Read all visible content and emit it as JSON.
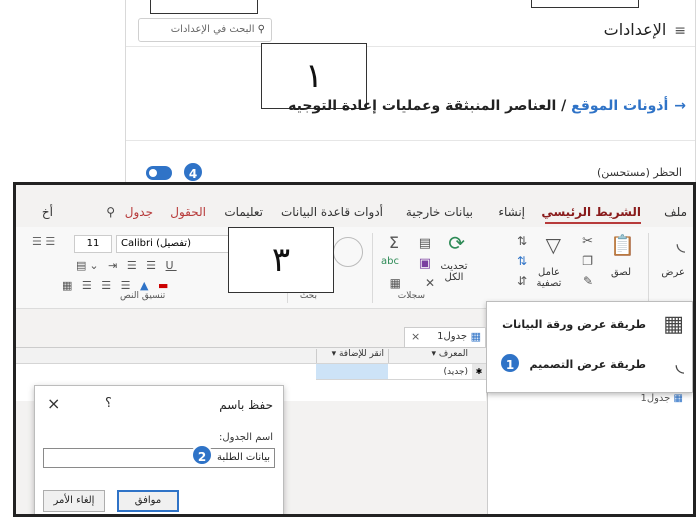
{
  "settings_page": {
    "title": "الإعدادات",
    "menu_icon": "menu-icon",
    "search_placeholder": "البحث في الإعدادات",
    "search_icon": "search-icon",
    "breadcrumb_link": "أذونات الموقع",
    "breadcrumb_sep": "/",
    "breadcrumb_current": "العناصر المنبثقة وعمليات إعادة التوجيه",
    "back_icon": "arrow-back-icon",
    "block_label": "الحظر (مستحسن)",
    "toggle_badge": "4",
    "frame_1_label": "١"
  },
  "access": {
    "tabs": {
      "file": "ملف",
      "home": "الشريط الرئيسي",
      "create": "إنشاء",
      "external": "بيانات خارجية",
      "db_tools": "أدوات قاعدة البيانات",
      "help": "تعليمات",
      "fields": "الحقول",
      "table": "جدول",
      "tell": "أخ"
    },
    "ribbon": {
      "view_label": "عرض",
      "paste_label": "لصق",
      "filter_label": "عامل تصفية",
      "refresh_label": "تحديث الكل",
      "font_name": "Calibri (تفصيل)",
      "font_size": "11",
      "group_records": "سجلات",
      "group_find": "بحث",
      "group_text": "تنسيق النص",
      "frame_3_label": "٣"
    },
    "view_menu": {
      "datasheet": "طريقة عرض ورقة البيانات",
      "design": "طريقة عرض التصميم",
      "design_badge": "1"
    },
    "table_tab": {
      "name": "جدول1",
      "close": "×"
    },
    "grid": {
      "col_id": "المعرف",
      "col_add": "انقر للإضافة",
      "new_row": "(جديد)"
    },
    "nav_item": "جدول1",
    "save_dialog": {
      "title": "حفظ باسم",
      "help": "؟",
      "close": "×",
      "field_label": "اسم الجدول:",
      "field_value": "بيانات الطلبة",
      "badge": "2",
      "ok": "موافق",
      "cancel": "إلغاء الأمر"
    }
  },
  "colors": {
    "accent_blue": "#2f73c7",
    "home_tab_red": "#8a1c1c",
    "selection_blue": "#d5e7f7"
  }
}
